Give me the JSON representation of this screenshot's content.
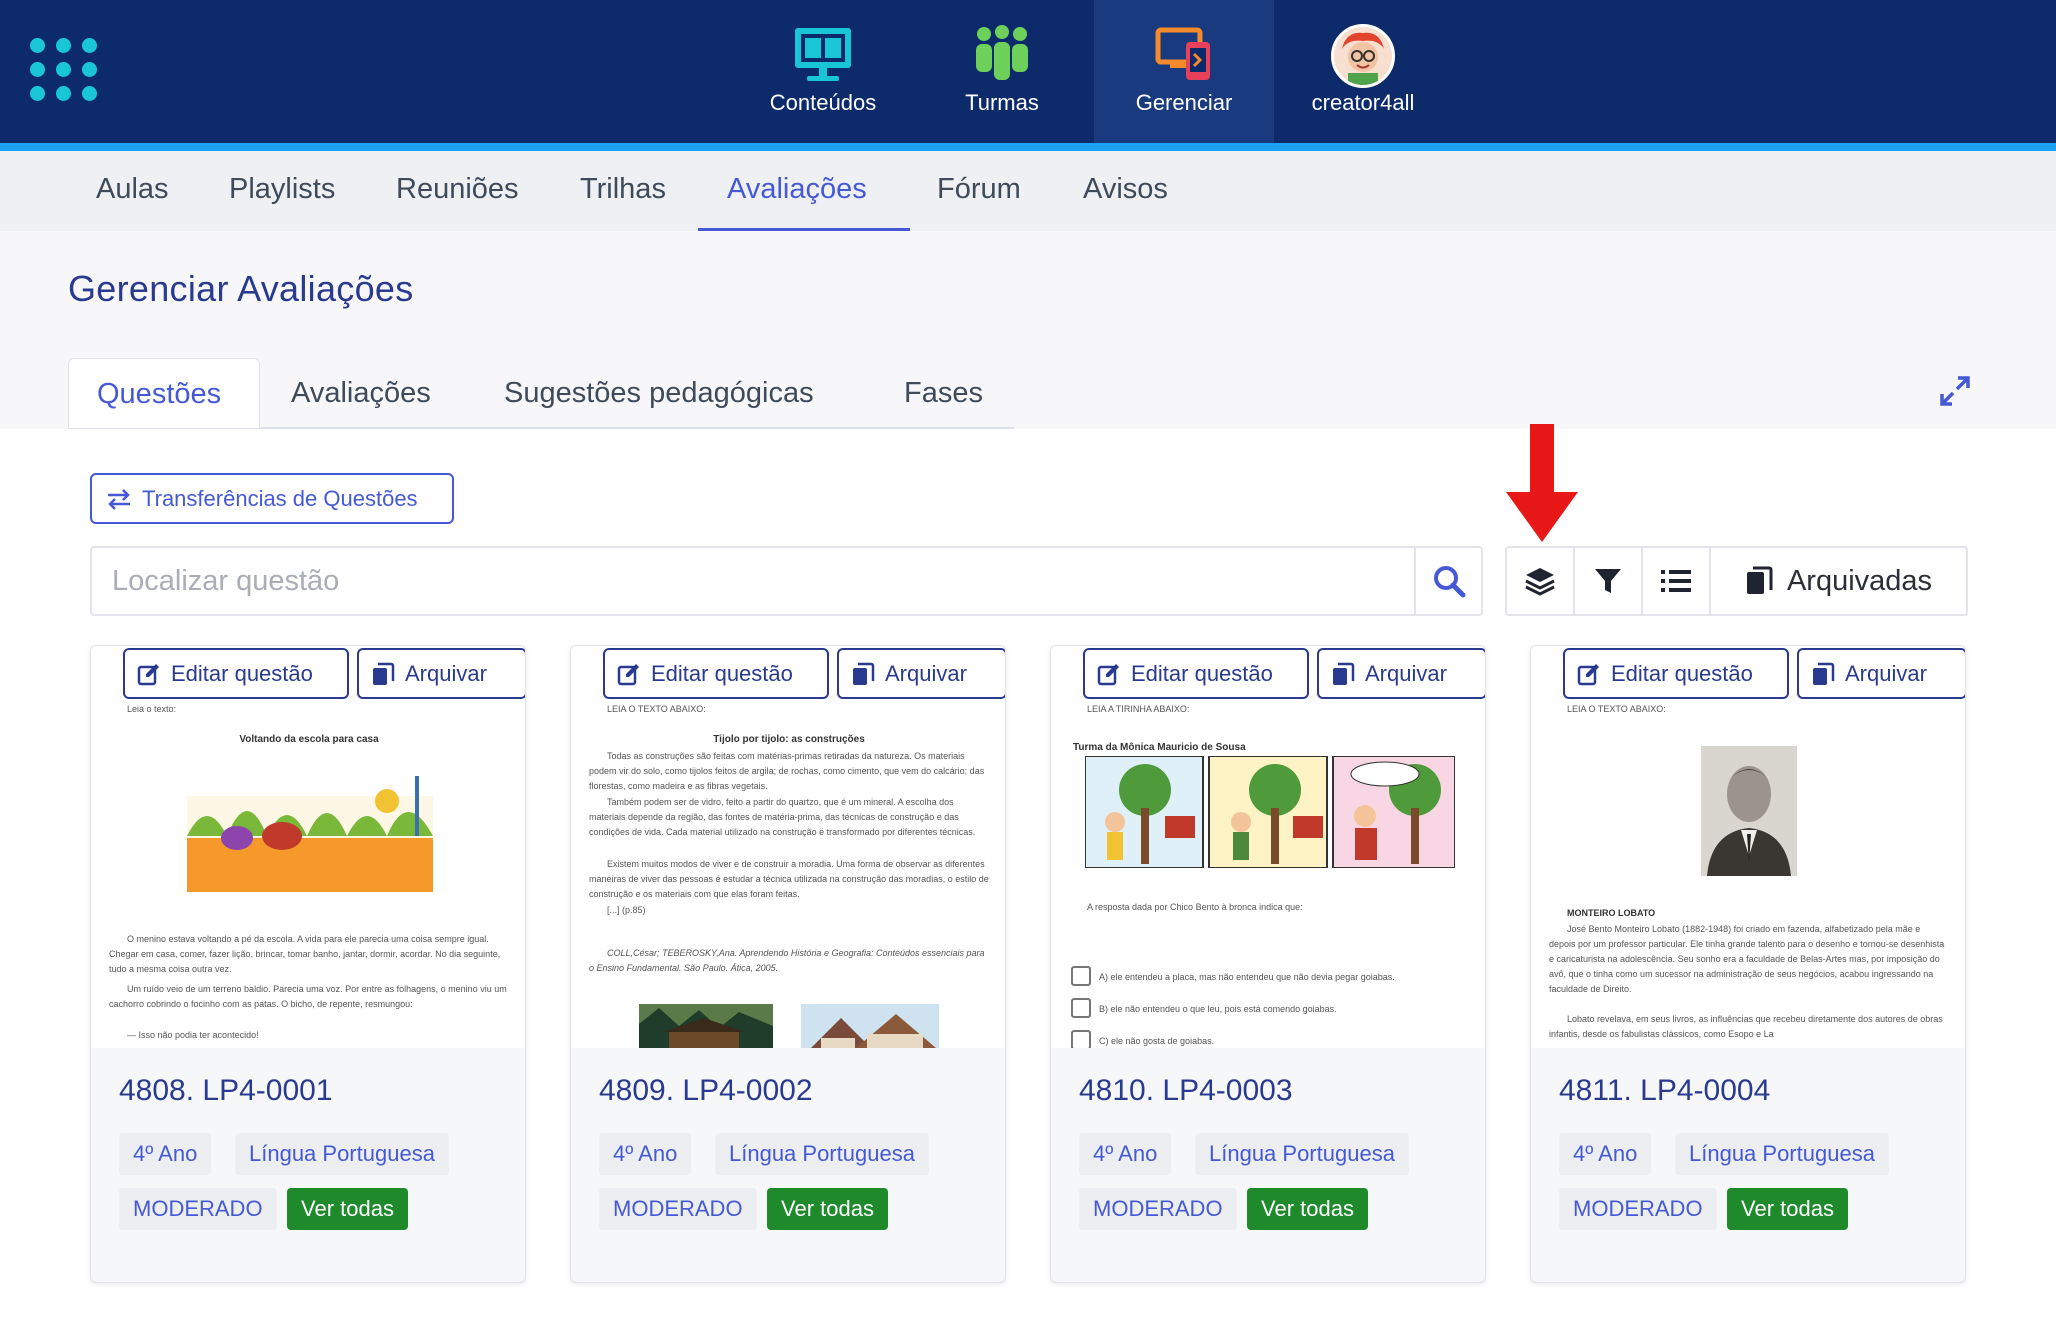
{
  "topnav": {
    "items": [
      {
        "label": "Conteúdos",
        "icon": "monitor-icon"
      },
      {
        "label": "Turmas",
        "icon": "people-icon"
      },
      {
        "label": "Gerenciar",
        "icon": "devices-icon"
      },
      {
        "label": "creator4all",
        "icon": "avatar"
      }
    ]
  },
  "subnav": {
    "items": [
      "Aulas",
      "Playlists",
      "Reuniões",
      "Trilhas",
      "Avaliações",
      "Fórum",
      "Avisos"
    ],
    "active": "Avaliações"
  },
  "page": {
    "title": "Gerenciar Avaliações"
  },
  "tabs": {
    "items": [
      "Questões",
      "Avaliações",
      "Sugestões pedagógicas",
      "Fases"
    ],
    "active": "Questões"
  },
  "transfer_button": "Transferências de Questões",
  "search": {
    "placeholder": "Localizar questão"
  },
  "toolbar": {
    "archived_label": "Arquivadas"
  },
  "card_actions": {
    "edit": "Editar questão",
    "archive": "Arquivar"
  },
  "cards": [
    {
      "code": "4808. LP4-0001",
      "grade": "4º Ano",
      "subject": "Língua Portuguesa",
      "status": "MODERADO",
      "see_all": "Ver todas",
      "preview": {
        "intro": "Leia o texto:",
        "heading": "Voltando da escola para casa",
        "p1": "O menino estava voltando a pé da escola. A vida para ele parecia uma coisa sempre igual. Chegar em casa, comer, fazer lição, brincar, tomar banho, jantar, dormir, acordar. No dia seguinte, tudo a mesma coisa outra vez.",
        "p2": "Um ruído veio de um terreno baldio. Parecia uma voz. Por entre as folhagens, o menino viu um cachorro cobrindo o focinho com as patas. O bicho, de repente, resmungou:",
        "p3": "— Isso não podia ter acontecido!"
      }
    },
    {
      "code": "4809. LP4-0002",
      "grade": "4º Ano",
      "subject": "Língua Portuguesa",
      "status": "MODERADO",
      "see_all": "Ver todas",
      "preview": {
        "intro": "LEIA O TEXTO ABAIXO:",
        "heading": "Tijolo por tijolo: as construções",
        "p1": "Todas as construções são feitas com matérias-primas retiradas da natureza. Os materiais podem vir do solo, como tijolos feitos de argila; de rochas, como cimento, que vem do calcário; das florestas, como madeira e as fibras vegetais.",
        "p2": "Também podem ser de vidro, feito a partir do quartzo, que é um mineral. A escolha dos materiais depende da região, das fontes de matéria-prima, das técnicas de construção e das condições de vida. Cada material utilizado na construção é transformado por diferentes técnicas.",
        "p3": "Existem muitos modos de viver e de construir a moradia. Uma forma de observar as diferentes maneiras de viver das pessoas é estudar a técnica utilizada na construção das moradias, o estilo de construção e os materiais com que elas foram feitas.",
        "p4": "[...] (p.85)",
        "ref": "COLL,César; TEBEROSKY,Ana. Aprendendo História e Geografia: Conteúdos essenciais para o Ensino Fundamental. São Paulo. Ática, 2005."
      }
    },
    {
      "code": "4810. LP4-0003",
      "grade": "4º Ano",
      "subject": "Língua Portuguesa",
      "status": "MODERADO",
      "see_all": "Ver todas",
      "preview": {
        "intro": "LEIA A TIRINHA ABAIXO:",
        "heading": "Turma da Mônica Mauricio de Sousa",
        "question": "A resposta dada por Chico Bento à bronca indica que:",
        "opt_a": "A) ele entendeu a placa, mas não entendeu que não devia pegar goiabas.",
        "opt_b": "B) ele não entendeu o que leu, pois está comendo goiabas.",
        "opt_c": "C) ele não gosta de goiabas."
      }
    },
    {
      "code": "4811. LP4-0004",
      "grade": "4º Ano",
      "subject": "Língua Portuguesa",
      "status": "MODERADO",
      "see_all": "Ver todas",
      "preview": {
        "intro": "LEIA O TEXTO ABAIXO:",
        "heading": "MONTEIRO LOBATO",
        "p1": "José Bento Monteiro Lobato (1882-1948) foi criado em fazenda, alfabetizado pela mãe e depois por um professor particular. Ele tinha grande talento para o desenho e tornou-se desenhista e caricaturista na adolescência. Seu sonho era a faculdade de Belas-Artes mas, por imposição do avô, que o tinha como um sucessor na administração de seus negócios, acabou ingressando na faculdade de Direito.",
        "p2": "Lobato revelava, em seus livros, as influências que recebeu diretamente dos autores de obras infantis, desde os fabulistas clássicos, como Esopo e La"
      }
    }
  ],
  "colors": {
    "topbar": "#0d2a6b",
    "accent": "#1da1f2",
    "primary": "#4559d6",
    "title": "#2a3a8f",
    "success": "#1f8a2c"
  }
}
